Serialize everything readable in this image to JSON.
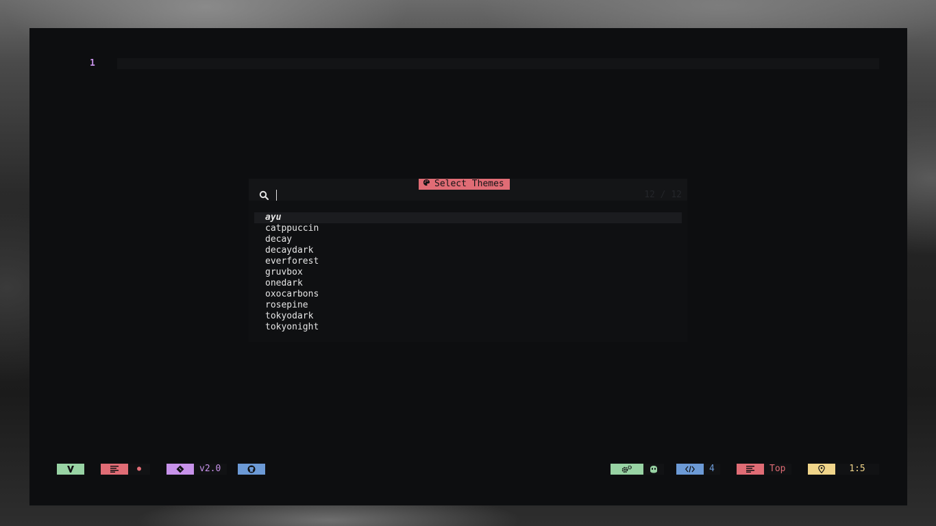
{
  "editor": {
    "line_numbers": [
      "1"
    ]
  },
  "picker": {
    "title": "Select Themes",
    "title_icon": "palette-icon",
    "search_icon": "search-icon",
    "query": "",
    "count": "12 / 12",
    "results": [
      "ayu",
      "catppuccin",
      "decay",
      "decaydark",
      "everforest",
      "gruvbox",
      "onedark",
      "oxocarbons",
      "rosepine",
      "tokyodark",
      "tokyonight"
    ],
    "selected_index": 0
  },
  "statusline": {
    "mode_icon": "vim-icon",
    "file_icon": "file-lines-icon",
    "modified_indicator": "●",
    "git_icon": "git-branch-icon",
    "branch": "v2.0",
    "repo_icon": "github-icon",
    "lsp_icon": "gears-icon",
    "copilot_icon": "copilot-icon",
    "indent_icon": "code-icon",
    "indent_value": "4",
    "position_icon": "file-lines-icon",
    "scroll_position": "Top",
    "location_icon": "location-pin-icon",
    "cursor_location": "1:5"
  },
  "colors": {
    "green": "#98d3a4",
    "red": "#e06c75",
    "purple": "#c792ea",
    "blue": "#6c9ad6",
    "yellow": "#f0d58a",
    "editor_bg": "#0d0e10",
    "text": "#e6e6e6"
  }
}
